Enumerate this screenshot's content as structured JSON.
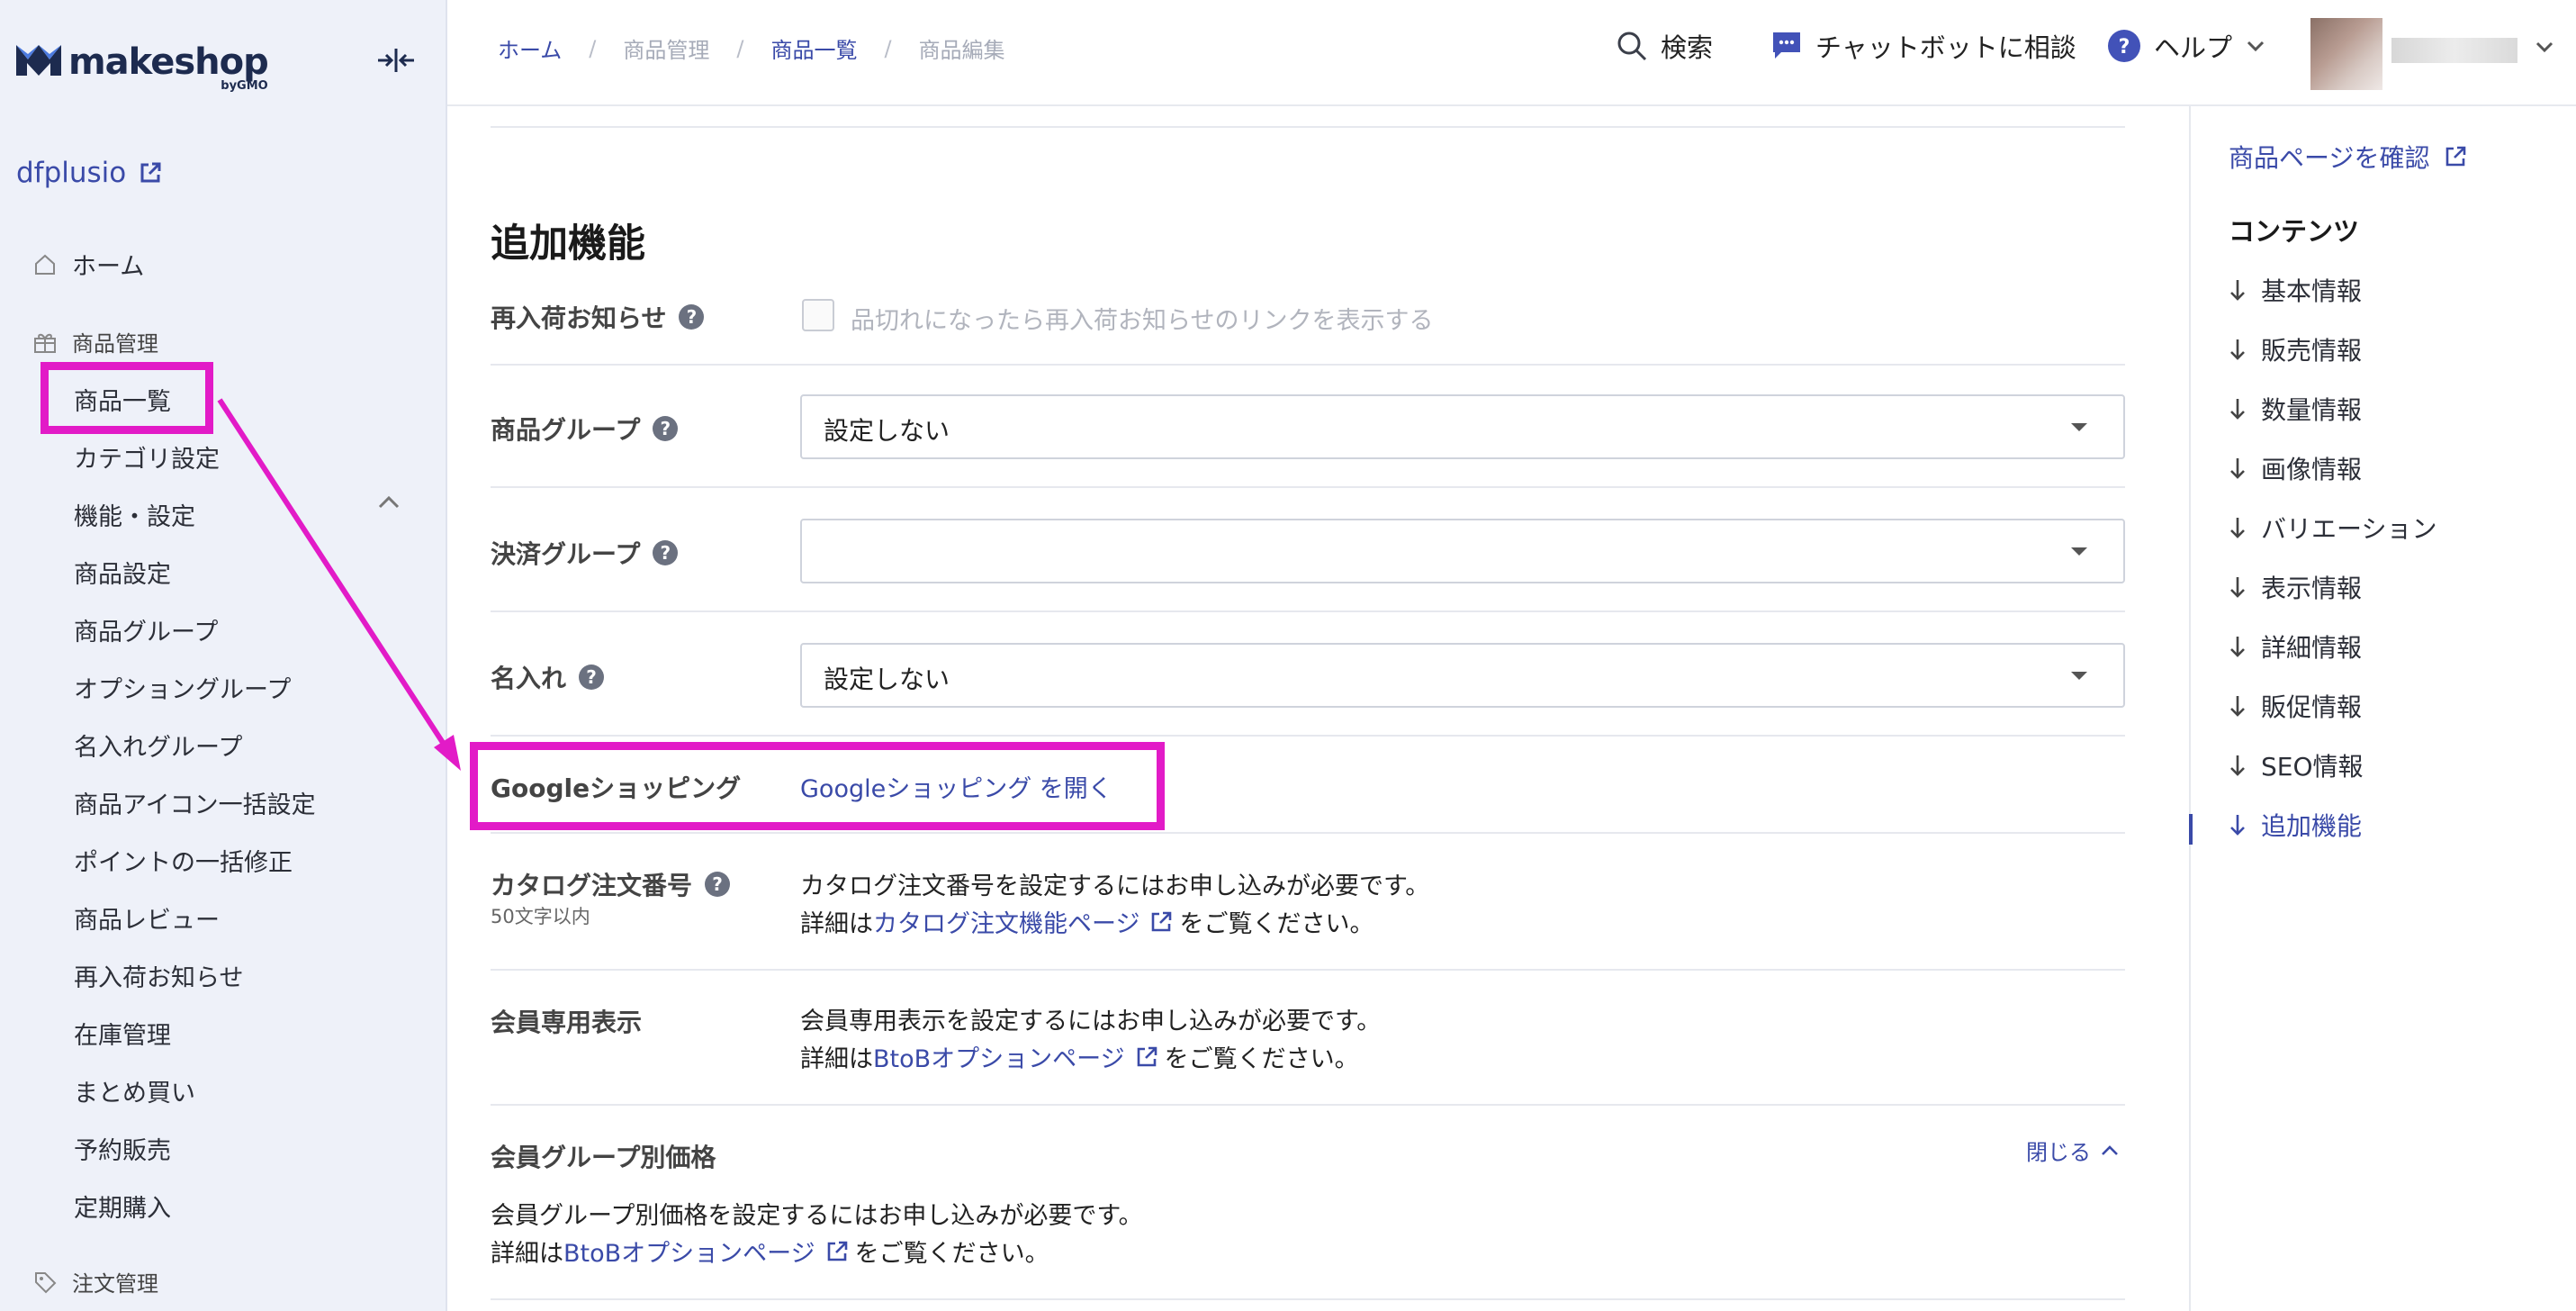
{
  "brand": {
    "name": "makeshop",
    "sub": "byGMO"
  },
  "shop": {
    "name": "dfplusio"
  },
  "sidebar": {
    "home_label": "ホーム",
    "products_section": "商品管理",
    "items": [
      "商品一覧",
      "カテゴリ設定",
      "機能・設定",
      "商品設定",
      "商品グループ",
      "オプショングループ",
      "名入れグループ",
      "商品アイコン一括設定",
      "ポイントの一括修正",
      "商品レビュー",
      "再入荷お知らせ",
      "在庫管理",
      "まとめ買い",
      "予約販売",
      "定期購入"
    ],
    "orders_section": "注文管理"
  },
  "header": {
    "breadcrumb": [
      "ホーム",
      "商品管理",
      "商品一覧",
      "商品編集"
    ],
    "search_label": "検索",
    "chatbot_label": "チャットボットに相談",
    "help_label": "ヘルプ"
  },
  "main": {
    "section_title": "追加機能",
    "restock": {
      "label": "再入荷お知らせ",
      "checkbox_label": "品切れになったら再入荷お知らせのリンクを表示する"
    },
    "product_group": {
      "label": "商品グループ",
      "value": "設定しない"
    },
    "payment_group": {
      "label": "決済グループ",
      "value": ""
    },
    "engraving": {
      "label": "名入れ",
      "value": "設定しない"
    },
    "google_shopping": {
      "label": "Googleショッピング",
      "link": "Googleショッピング を開く"
    },
    "catalog": {
      "label": "カタログ注文番号",
      "sub": "50文字以内",
      "line1": "カタログ注文番号を設定するにはお申し込みが必要です。",
      "detail_prefix": "詳細は",
      "link": "カタログ注文機能ページ",
      "suffix": "をご覧ください。"
    },
    "member_display": {
      "label": "会員専用表示",
      "line1": "会員専用表示を設定するにはお申し込みが必要です。",
      "detail_prefix": "詳細は",
      "link": "BtoBオプションページ",
      "suffix": "をご覧ください。"
    },
    "member_group_price": {
      "label": "会員グループ別価格",
      "toggle": "閉じる",
      "line1": "会員グループ別価格を設定するにはお申し込みが必要です。",
      "detail_prefix": "詳細は",
      "link": "BtoBオプションページ",
      "suffix": "をご覧ください。"
    }
  },
  "toc": {
    "confirm_label": "商品ページを確認",
    "title": "コンテンツ",
    "items": [
      "基本情報",
      "販売情報",
      "数量情報",
      "画像情報",
      "バリエーション",
      "表示情報",
      "詳細情報",
      "販促情報",
      "SEO情報",
      "追加機能"
    ],
    "active_index": 9
  },
  "colors": {
    "accent": "#3a4aa8",
    "sidebar_bg": "#eef1f9",
    "annotation": "#e21bc7",
    "help_icon": "#4252b8"
  }
}
